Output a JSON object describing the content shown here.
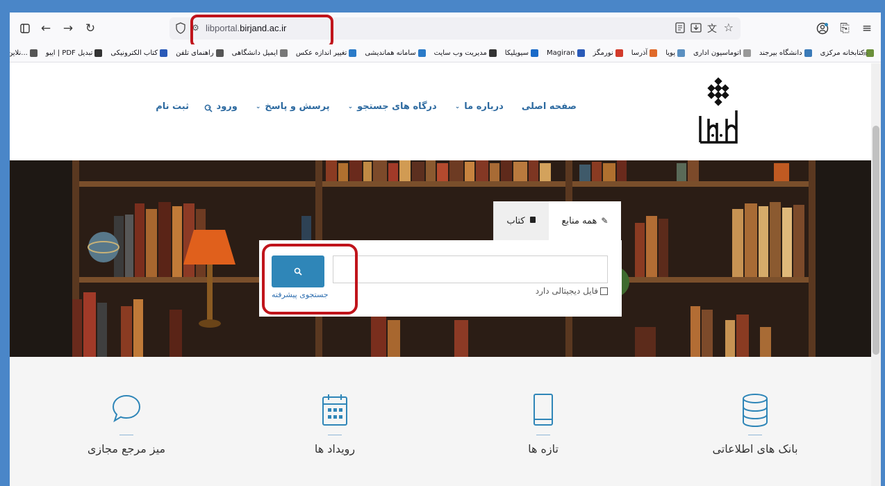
{
  "browser": {
    "url_prefix": "libportal.",
    "url_domain": "birjand.ac.ir",
    "bookmarks": [
      "کتابخانه مرکزی",
      "دانشگاه بیرجند",
      "اتوماسیون اداری",
      "پویا",
      "آذرسا",
      "نورمگز",
      "Magiran",
      "سیویلیکا",
      "مدیریت وب سایت",
      "سامانه هماندیشی",
      "تغییر اندازه عکس",
      "ایمیل دانشگاهی",
      "راهنمای تلفن",
      "کتاب الکترونیکی",
      "تبدیل PDF | ایبو",
      "...نلاین رایگان"
    ]
  },
  "header": {
    "nav": [
      {
        "label": "صفحه اصلی",
        "has_dropdown": false
      },
      {
        "label": "درباره ما",
        "has_dropdown": true
      },
      {
        "label": "درگاه های جستجو",
        "has_dropdown": true
      },
      {
        "label": "پرسش و پاسخ",
        "has_dropdown": true
      },
      {
        "label": "ورود",
        "has_dropdown": true
      },
      {
        "label": "ثبت نام",
        "has_dropdown": false
      }
    ]
  },
  "search": {
    "tabs": [
      {
        "label": "همه منابع",
        "active": true
      },
      {
        "label": "کتاب",
        "active": false
      }
    ],
    "query_value": "",
    "digital_file_label": "فایل دیجیتالی دارد",
    "advanced_search_label": "جستجوی پیشرفته"
  },
  "features": [
    {
      "label": "بانک های اطلاعاتی",
      "icon": "database-icon"
    },
    {
      "label": "تازه ها",
      "icon": "book-icon"
    },
    {
      "label": "رویداد ها",
      "icon": "calendar-icon"
    },
    {
      "label": "میز مرجع مجازی",
      "icon": "chat-bubble-icon"
    }
  ],
  "colors": {
    "accent": "#2f86b8",
    "nav_text": "#2d6aa0",
    "highlight": "#c0141b"
  }
}
